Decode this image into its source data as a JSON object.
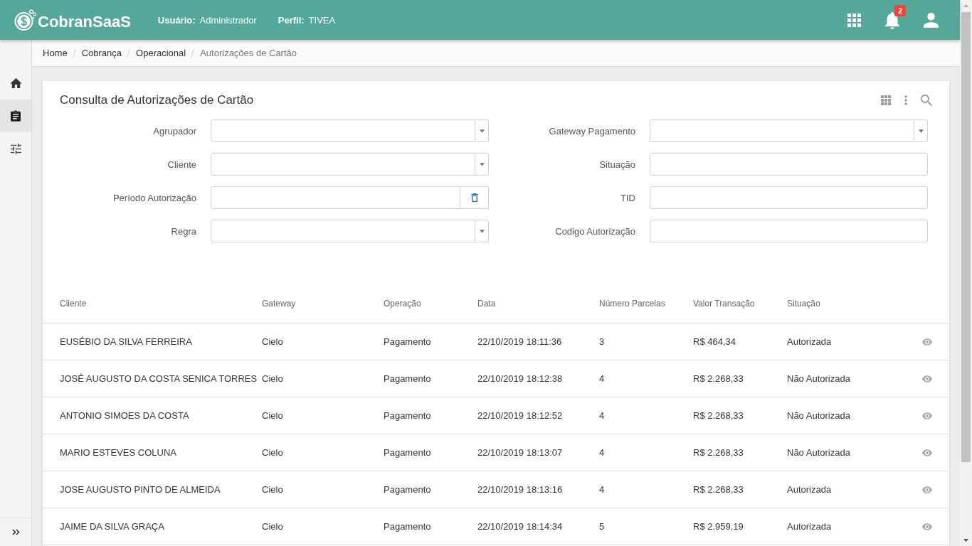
{
  "header": {
    "logo": "CobranSaaS",
    "user": {
      "label": "Usuário:",
      "value": "Administrador"
    },
    "profile": {
      "label": "Perfil:",
      "value": "TIVEA"
    },
    "notifications": {
      "count": "2"
    }
  },
  "sidebar": {
    "items": [
      {
        "kind": "home",
        "selected": false
      },
      {
        "kind": "clipboard",
        "selected": true
      },
      {
        "kind": "sliders",
        "selected": false
      }
    ]
  },
  "breadcrumb": [
    {
      "label": "Home",
      "current": false
    },
    {
      "label": "Cobrança",
      "current": false
    },
    {
      "label": "Operacional",
      "current": false
    },
    {
      "label": "Autorizações de Cartão",
      "current": true
    }
  ],
  "panel": {
    "title": "Consulta de Autorizações de Cartão"
  },
  "filters": [
    {
      "label": "Agrupador",
      "kind": "select"
    },
    {
      "label": "Gateway Pagamento",
      "kind": "select"
    },
    {
      "label": "Cliente",
      "kind": "select"
    },
    {
      "label": "Situação",
      "kind": "text"
    },
    {
      "label": "Período Autorização",
      "kind": "date"
    },
    {
      "label": "TID",
      "kind": "text"
    },
    {
      "label": "Regra",
      "kind": "select"
    },
    {
      "label": "Codigo Autorização",
      "kind": "text"
    }
  ],
  "table": {
    "columns": [
      "Cliente",
      "Gateway",
      "Operação",
      "Data",
      "Número Parcelas",
      "Valor Transação",
      "Situação"
    ],
    "rows": [
      {
        "cells": [
          "EUSÉBIO DA SILVA FERREIRA",
          "Cielo",
          "Pagamento",
          "22/10/2019 18:11:36",
          "3",
          "R$ 464,34",
          "Autorizada"
        ]
      },
      {
        "cells": [
          "JOSÉ AUGUSTO DA COSTA SENICA TORRES",
          "Cielo",
          "Pagamento",
          "22/10/2019 18:12:38",
          "4",
          "R$ 2.268,33",
          "Não Autorizada"
        ]
      },
      {
        "cells": [
          "ANTONIO SIMOES DA COSTA",
          "Cielo",
          "Pagamento",
          "22/10/2019 18:12:52",
          "4",
          "R$ 2.268,33",
          "Não Autorizada"
        ]
      },
      {
        "cells": [
          "MARIO ESTEVES COLUNA",
          "Cielo",
          "Pagamento",
          "22/10/2019 18:13:07",
          "4",
          "R$ 2.268,33",
          "Não Autorizada"
        ]
      },
      {
        "cells": [
          "JOSE AUGUSTO PINTO DE ALMEIDA",
          "Cielo",
          "Pagamento",
          "22/10/2019 18:13:16",
          "4",
          "R$ 2.268,33",
          "Autorizada"
        ]
      },
      {
        "cells": [
          "JAIME DA SILVA GRAÇA",
          "Cielo",
          "Pagamento",
          "22/10/2019 18:14:34",
          "5",
          "R$ 2.959,19",
          "Autorizada"
        ]
      }
    ]
  }
}
